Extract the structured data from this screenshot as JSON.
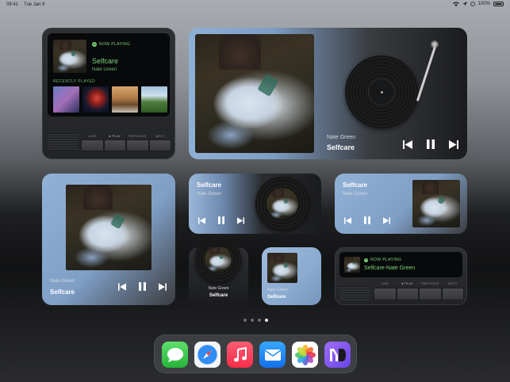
{
  "status": {
    "time": "09:41",
    "date": "Tue Jan 9",
    "battery": "100%"
  },
  "track": {
    "title": "Selfcare",
    "artist": "Nate Green",
    "combined": "Selfcare-Nate Green"
  },
  "labels": {
    "now_playing": "NOW PLAYING",
    "recently_played": "RECENTLY PLAYED"
  },
  "device_keys": [
    "LIKE",
    "● PLAY",
    "PREVIOUS",
    "NEXT"
  ],
  "pager": {
    "pages": 4,
    "active": 4
  },
  "dock_apps": [
    {
      "name": "messages",
      "icon": "messages-icon",
      "color": "#3ec84b"
    },
    {
      "name": "safari",
      "icon": "safari-icon",
      "color": "#1e7cf0"
    },
    {
      "name": "music",
      "icon": "music-icon",
      "color": "#fa2d48"
    },
    {
      "name": "mail",
      "icon": "mail-icon",
      "color": "#1b8cf5"
    },
    {
      "name": "photos",
      "icon": "photos-icon",
      "color": "#ffffff"
    },
    {
      "name": "widget-app",
      "icon": "m-logo-icon",
      "color": "#7d55f0"
    }
  ],
  "colors": {
    "accent_green": "#7bd67b",
    "widget_blue": "#8caed4"
  }
}
